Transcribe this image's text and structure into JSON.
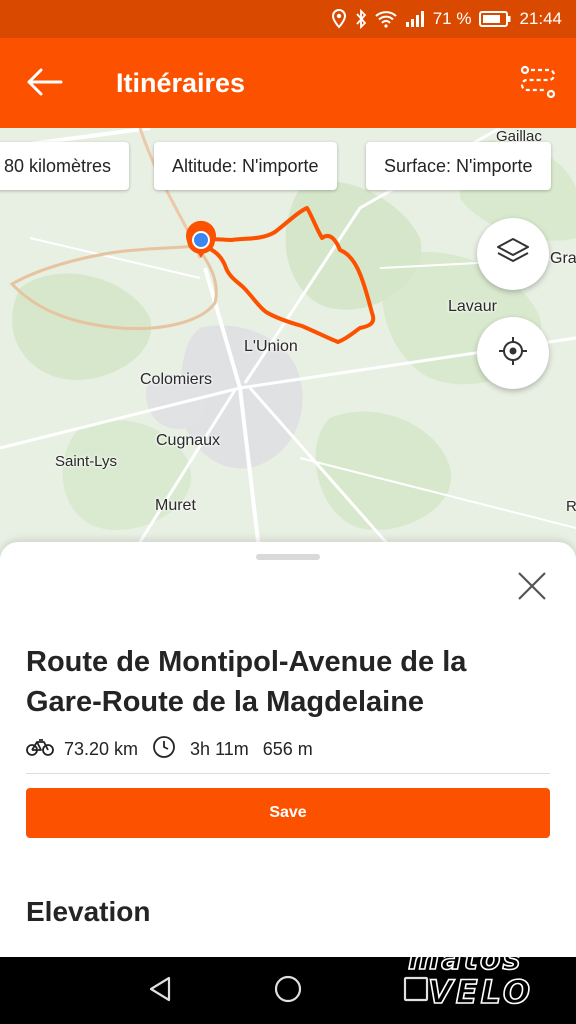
{
  "status_bar": {
    "battery": "71 %",
    "time": "21:44"
  },
  "app_bar": {
    "title": "Itinéraires",
    "back_icon": "arrow-left-icon",
    "menu_icon": "route-icon"
  },
  "filters": [
    {
      "label": "80 kilomètres"
    },
    {
      "label": "Altitude: N'importe"
    },
    {
      "label": "Surface: N'importe"
    }
  ],
  "map": {
    "places": [
      "Gaillac",
      "Gra",
      "Lavaur",
      "L'Union",
      "Colomiers",
      "Cugnaux",
      "Saint-Lys",
      "Muret",
      "R"
    ],
    "layers_icon": "layers-icon",
    "locate_icon": "crosshair-icon",
    "route_color": "#fc5200"
  },
  "sheet": {
    "title": "Route de Montipol-Avenue de la Gare-Route de la Magdelaine",
    "distance": "73.20 km",
    "duration": "3h 11m",
    "elevation_gain": "656 m",
    "save_label": "Save",
    "elevation_heading": "Elevation"
  },
  "watermark": {
    "text": "matos VELO"
  },
  "colors": {
    "accent": "#fc5200",
    "status_bar": "#d94a00"
  }
}
